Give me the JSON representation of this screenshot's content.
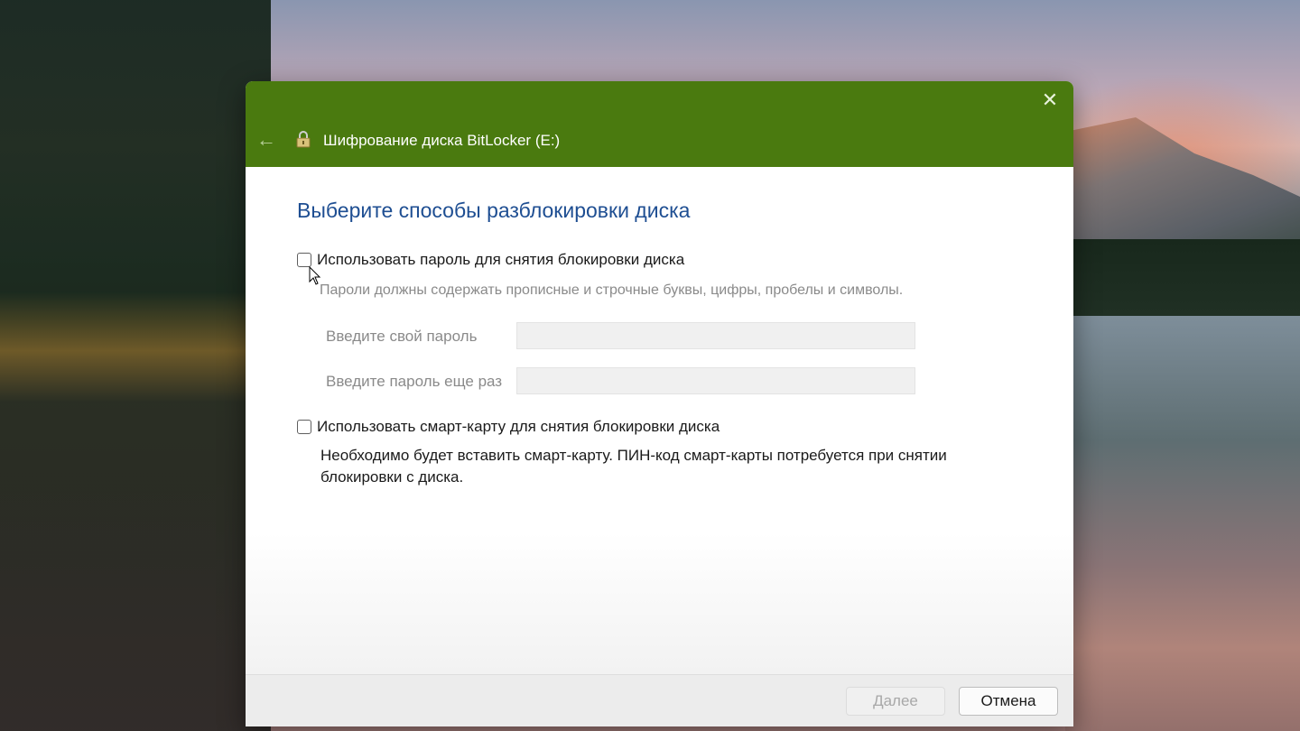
{
  "window": {
    "title": "Шифрование диска BitLocker (E:)",
    "close_glyph": "✕",
    "back_glyph": "←",
    "accent_color": "#4a7a0f"
  },
  "content": {
    "heading": "Выберите способы разблокировки диска",
    "password_option": {
      "label": "Использовать пароль для снятия блокировки диска",
      "checked": false,
      "hint": "Пароли должны содержать прописные и строчные буквы, цифры, пробелы и символы.",
      "password_label": "Введите свой пароль",
      "password_value": "",
      "confirm_label": "Введите пароль еще раз",
      "confirm_value": ""
    },
    "smartcard_option": {
      "label": "Использовать смарт-карту для снятия блокировки диска",
      "checked": false,
      "hint": "Необходимо будет вставить смарт-карту. ПИН-код смарт-карты потребуется при снятии блокировки с диска."
    }
  },
  "footer": {
    "next_label": "Далее",
    "next_disabled": true,
    "cancel_label": "Отмена"
  }
}
